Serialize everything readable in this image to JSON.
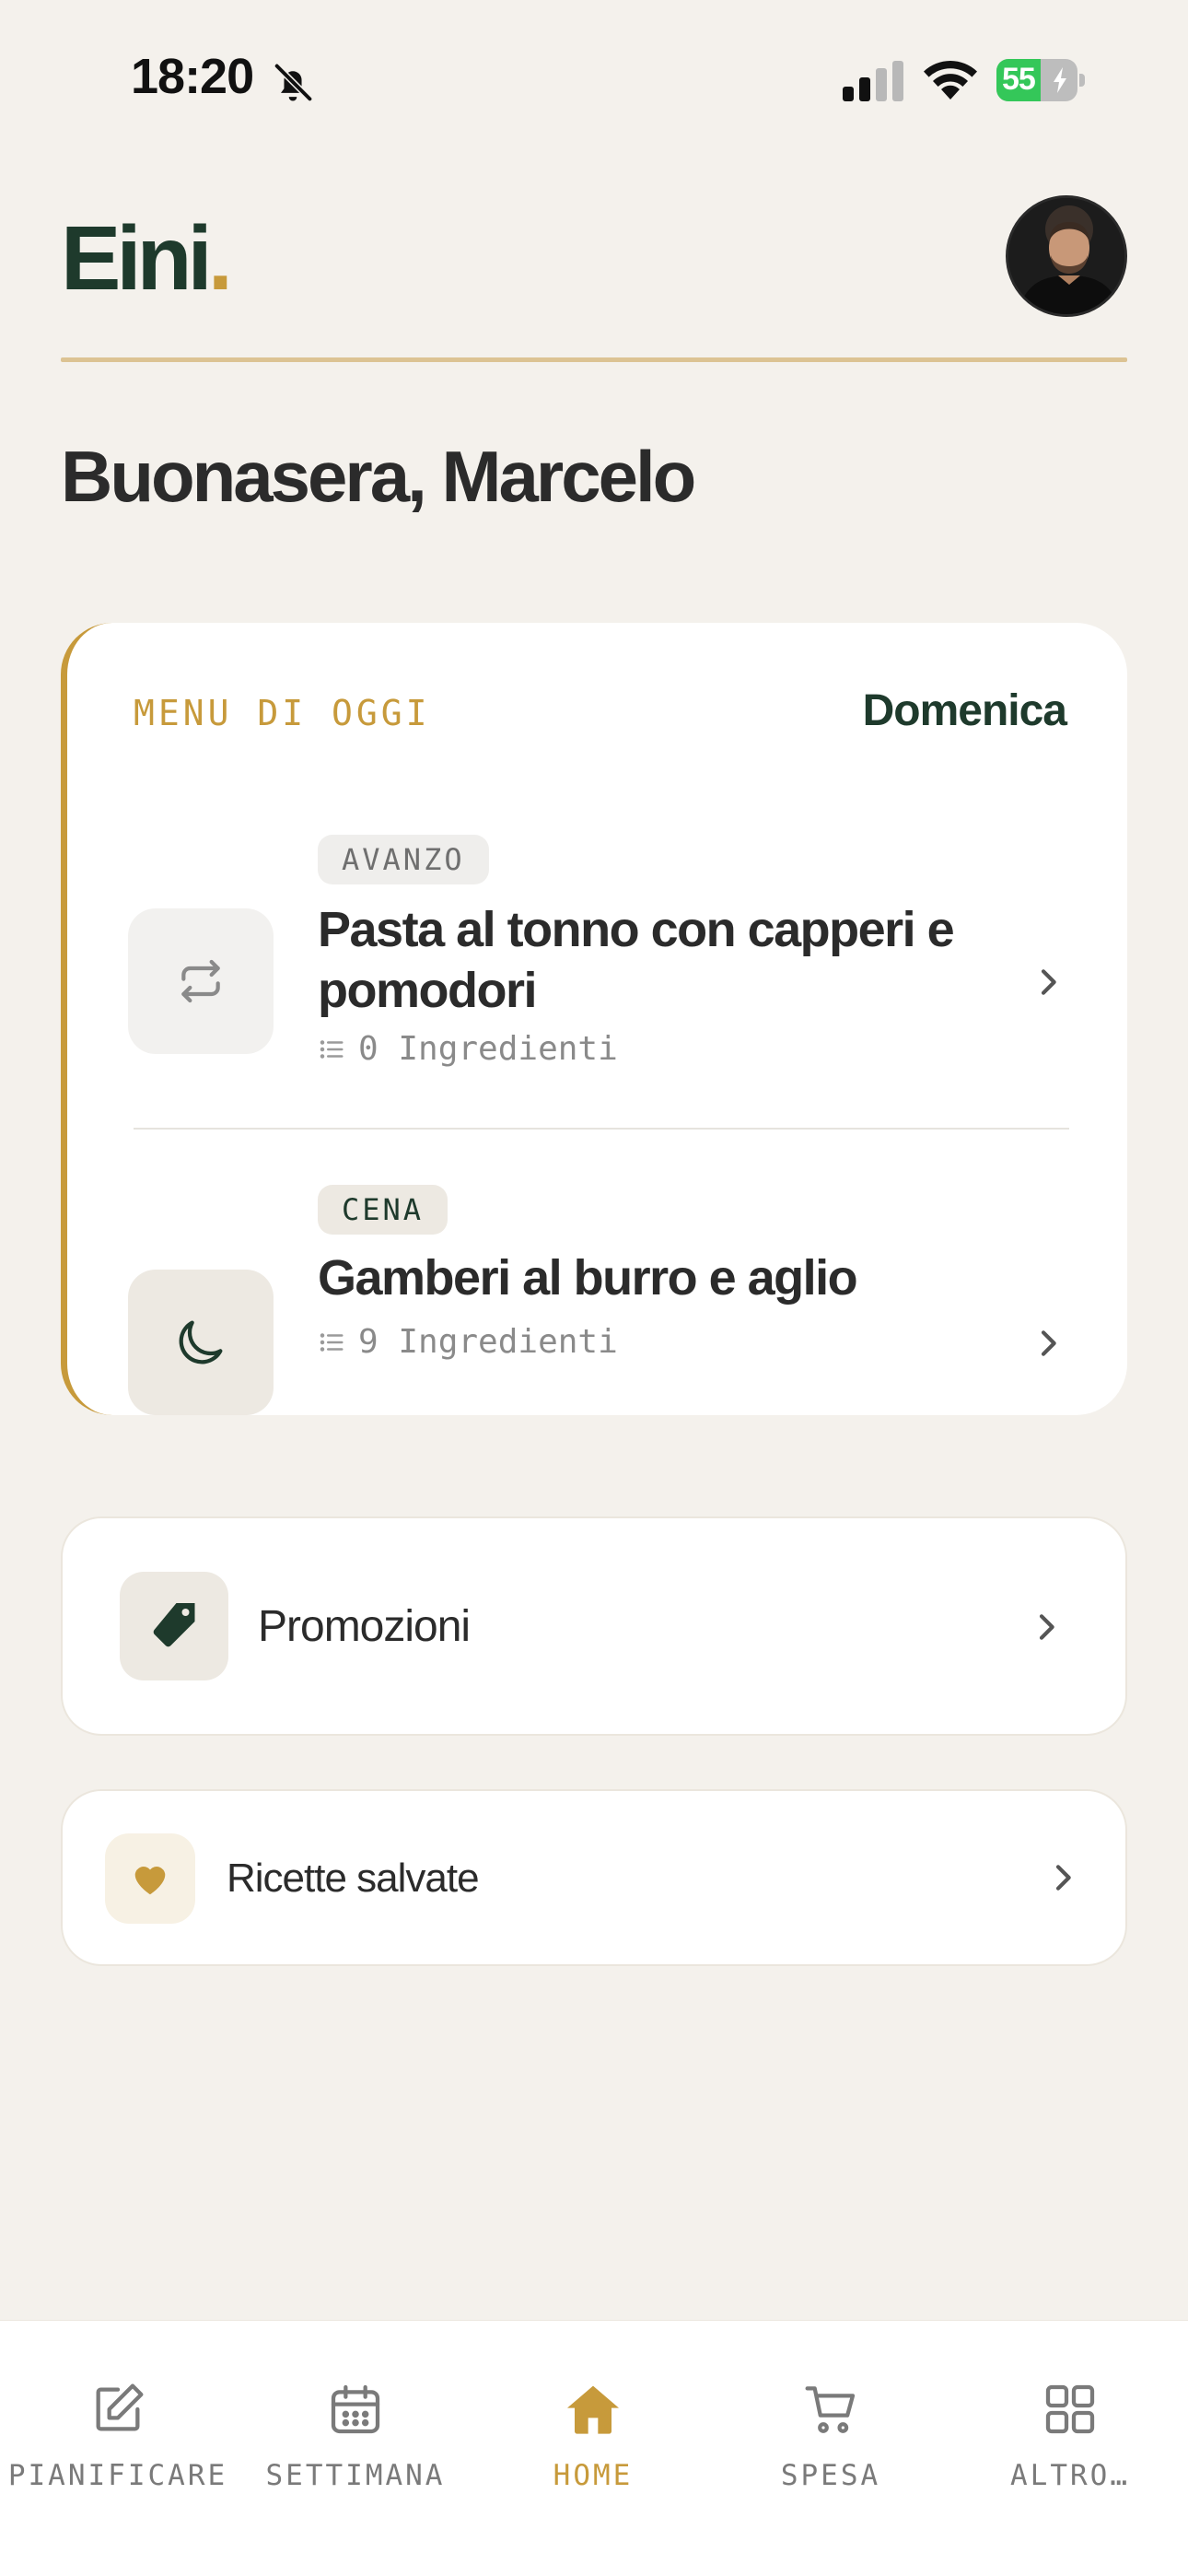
{
  "status_bar": {
    "time": "18:20",
    "battery": "55",
    "battery_level": 0.55
  },
  "header": {
    "brand": "Eini",
    "brand_dot": "."
  },
  "greeting": "Buonasera, Marcelo",
  "menu": {
    "label": "MENU DI OGGI",
    "day": "Domenica",
    "meals": [
      {
        "badge": "AVANZO",
        "title": "Pasta al tonno con capperi e pomodori",
        "ingredients": "0 Ingredienti",
        "icon": "repeat-icon"
      },
      {
        "badge": "CENA",
        "title": "Gamberi al burro e aglio",
        "ingredients": "9 Ingredienti",
        "icon": "moon-icon"
      }
    ]
  },
  "links": {
    "promotions": {
      "label": "Promozioni",
      "icon": "tag-icon"
    },
    "saved": {
      "label": "Ricette salvate",
      "icon": "heart-icon"
    }
  },
  "tabs": [
    {
      "label": "PIANIFICARE",
      "icon": "edit-icon"
    },
    {
      "label": "SETTIMANA",
      "icon": "calendar-icon"
    },
    {
      "label": "HOME",
      "icon": "home-icon",
      "active": true
    },
    {
      "label": "SPESA",
      "icon": "cart-icon"
    },
    {
      "label": "ALTRO…",
      "icon": "grid-icon"
    }
  ],
  "colors": {
    "brand_green": "#1e3a2c",
    "accent_gold": "#c79a3b",
    "background": "#f4f1ec"
  }
}
